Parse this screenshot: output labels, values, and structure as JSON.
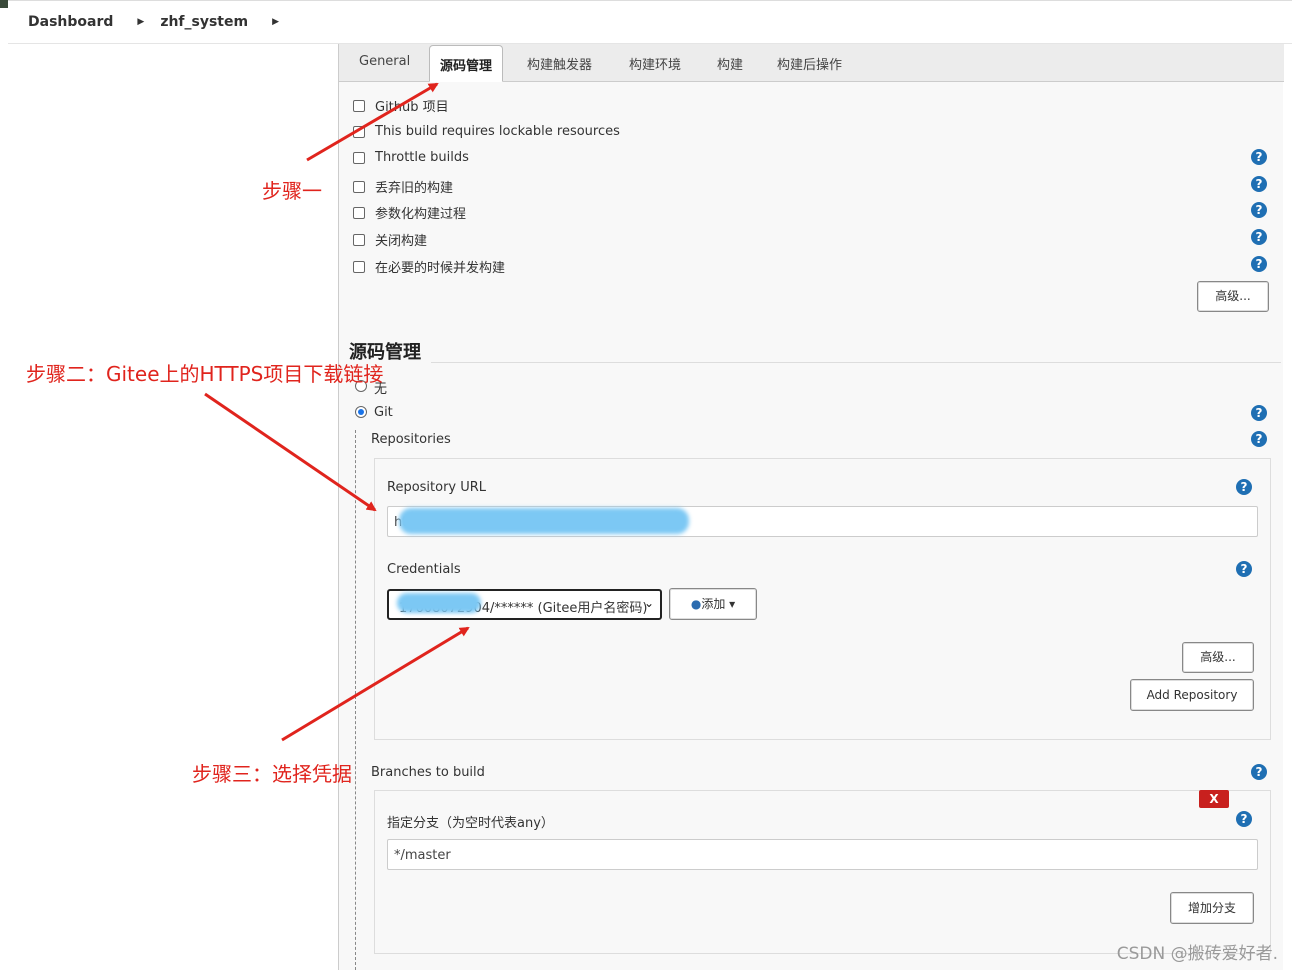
{
  "breadcrumb": {
    "items": [
      "Dashboard",
      "zhf_system"
    ]
  },
  "tabs": [
    "General",
    "源码管理",
    "构建触发器",
    "构建环境",
    "构建",
    "构建后操作"
  ],
  "active_tab": "源码管理",
  "general_options": [
    "Github 项目",
    "This build requires lockable resources",
    "Throttle builds",
    "丢弃旧的构建",
    "参数化构建过程",
    "关闭构建",
    "在必要的时候并发构建"
  ],
  "advanced_button": "高级...",
  "scm": {
    "section_title": "源码管理",
    "option_none": "无",
    "option_git": "Git",
    "selected": "Git",
    "repositories_label": "Repositories",
    "repo_url_label": "Repository URL",
    "repo_url_value": "https:",
    "credentials_label": "Credentials",
    "credentials_value": "17608072904/****** (Gitee用户名密码)",
    "add_button": "添加",
    "advanced_button": "高级...",
    "add_repository_button": "Add Repository",
    "branches_label": "Branches to build",
    "branch_spec_label": "指定分支（为空时代表any）",
    "branch_spec_value": "*/master",
    "delete_branch_label": "X",
    "add_branch_button": "增加分支"
  },
  "annotations": {
    "step1": "步骤一",
    "step2": "步骤二：Gitee上的HTTPS项目下载链接",
    "step3": "步骤三：选择凭据"
  },
  "watermark": "CSDN @搬砖爱好者.",
  "colors": {
    "annotation": "#e0241d",
    "help_icon": "#1f6fb3",
    "delete_badge": "#c8201e",
    "blur_highlight": "#7cc8f4"
  }
}
